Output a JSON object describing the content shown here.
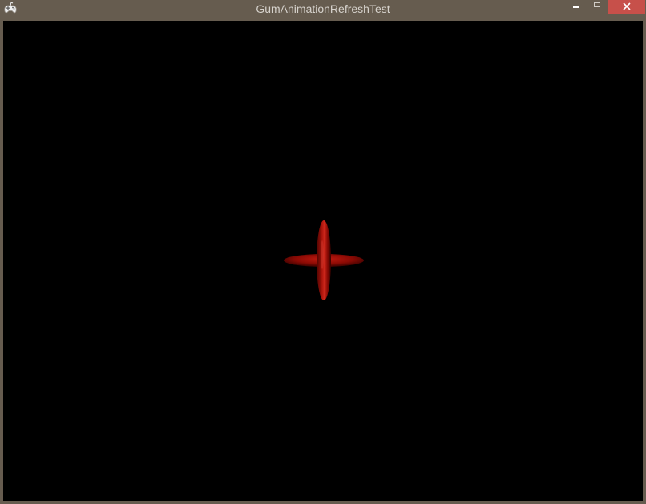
{
  "window": {
    "title": "GumAnimationRefreshTest",
    "app_icon": "gamepad-icon",
    "controls": {
      "minimize_icon": "minimize-icon",
      "maximize_icon": "maximize-icon",
      "close_icon": "close-icon"
    },
    "frame_color": "#665c4f",
    "close_color": "#c7504a"
  },
  "canvas": {
    "background": "#000000",
    "sprite": {
      "name": "red-cross-sprite",
      "color": "#8b0a04"
    }
  }
}
